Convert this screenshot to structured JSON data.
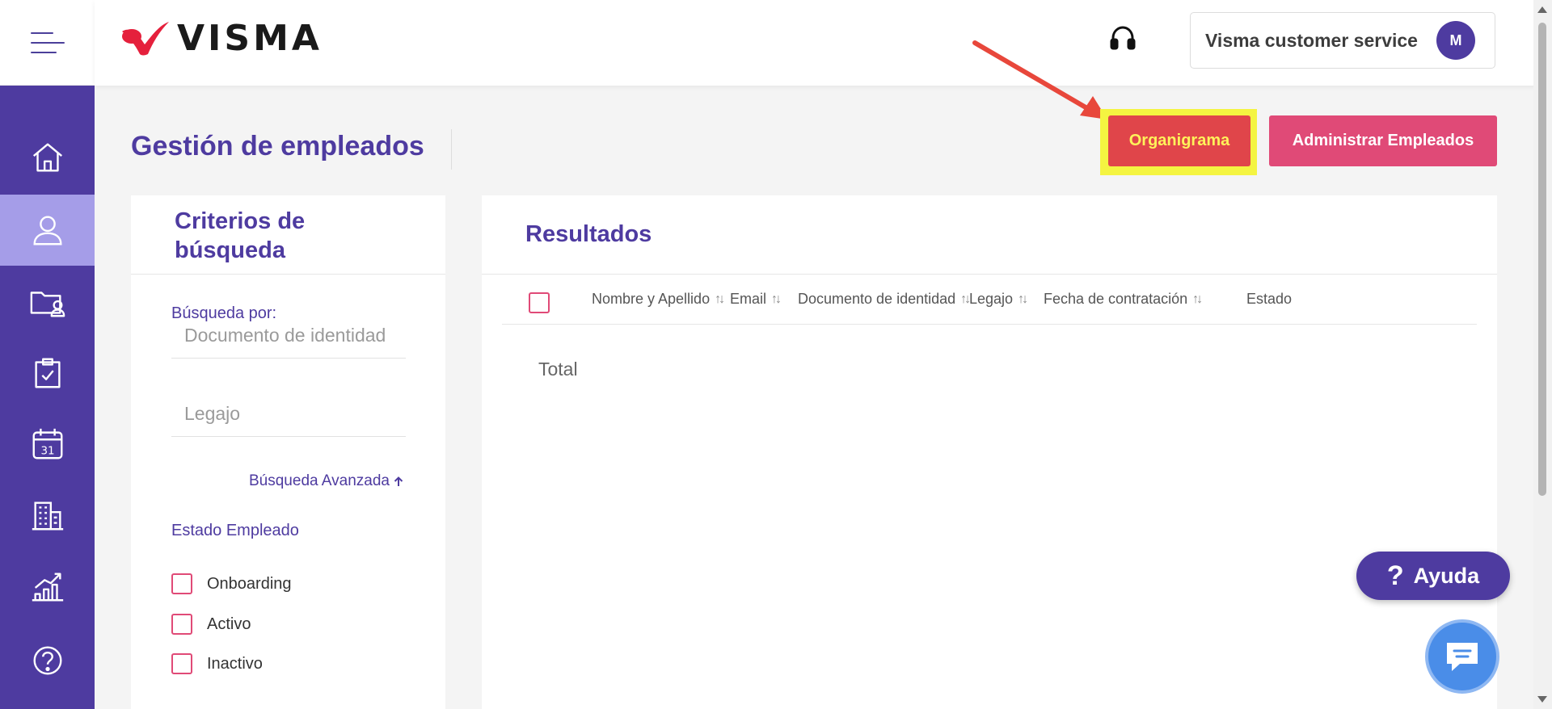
{
  "app": {
    "brand": "VISMA"
  },
  "header": {
    "user_name": "Visma customer service",
    "avatar_initial": "M"
  },
  "rail": {
    "items": [
      {
        "icon": "home-icon"
      },
      {
        "icon": "user-icon",
        "active": true
      },
      {
        "icon": "employee-folder-icon"
      },
      {
        "icon": "clipboard-check-icon"
      },
      {
        "icon": "calendar-icon",
        "day": "31"
      },
      {
        "icon": "building-icon"
      },
      {
        "icon": "chart-growth-icon"
      },
      {
        "icon": "help-circle-icon"
      }
    ]
  },
  "page": {
    "title": "Gestión de empleados",
    "btn_organigrama": "Organigrama",
    "btn_admin": "Administrar Empleados"
  },
  "search": {
    "title": "Criterios de búsqueda",
    "search_by_label": "Búsqueda por:",
    "doc_placeholder": "Documento de identidad",
    "legajo_placeholder": "Legajo",
    "advanced_link": "Búsqueda Avanzada",
    "estado_label": "Estado Empleado",
    "estados": [
      "Onboarding",
      "Activo",
      "Inactivo"
    ]
  },
  "results": {
    "title": "Resultados",
    "columns": [
      "Nombre y Apellido",
      "Email",
      "Documento de identidad",
      "Legajo",
      "Fecha de contratación",
      "Estado"
    ],
    "total_label": "Total"
  },
  "floating": {
    "help_label": "Ayuda",
    "help_symbol": "?"
  },
  "colors": {
    "brand": "#4e3ba0",
    "accent": "#e04a77",
    "highlight": "#f4f441",
    "arrow": "#e8473b"
  }
}
